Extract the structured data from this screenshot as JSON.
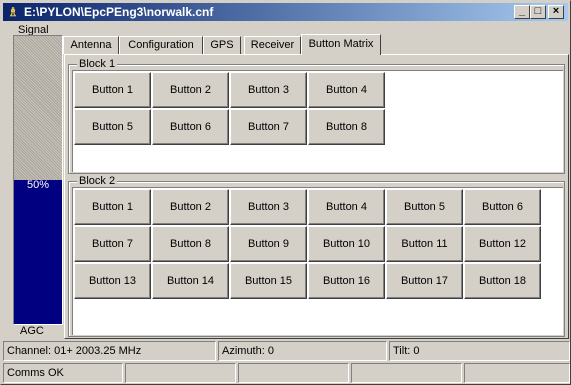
{
  "window": {
    "title": "E:\\PYLON\\EpcPEng3\\norwalk.cnf",
    "min": "_",
    "max": "□",
    "close": "×"
  },
  "signal": {
    "label": "Signal",
    "percent_text": "50%",
    "level": 0.5,
    "agc_label": "AGC",
    "fill_color": "#000080"
  },
  "tabs": [
    {
      "label": "Antenna"
    },
    {
      "label": "Configuration"
    },
    {
      "label": "GPS"
    },
    {
      "label": "Receiver"
    },
    {
      "label": "Button Matrix",
      "active": true
    }
  ],
  "block1": {
    "label": "Block 1",
    "buttons": [
      "Button 1",
      "Button 2",
      "Button 3",
      "Button 4",
      "Button 5",
      "Button 6",
      "Button 7",
      "Button 8"
    ]
  },
  "block2": {
    "label": "Block 2",
    "buttons": [
      "Button 1",
      "Button 2",
      "Button 3",
      "Button 4",
      "Button 5",
      "Button 6",
      "Button 7",
      "Button 8",
      "Button 9",
      "Button 10",
      "Button 11",
      "Button 12",
      "Button 13",
      "Button 14",
      "Button 15",
      "Button 16",
      "Button 17",
      "Button 18"
    ]
  },
  "status": {
    "channel": "Channel: 01+ 2003.25 MHz",
    "azimuth": "Azimuth: 0",
    "tilt": "Tilt: 0",
    "comms": "Comms OK"
  }
}
